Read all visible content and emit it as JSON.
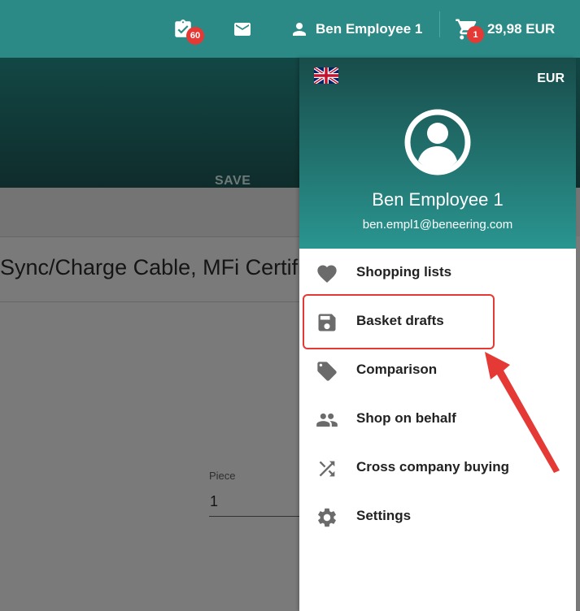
{
  "header": {
    "tasks": {
      "icon": "clipboard-check-icon",
      "badge": "60"
    },
    "messages": {
      "icon": "mail-icon"
    },
    "user": {
      "icon": "person-icon",
      "name": "Ben Employee 1"
    },
    "cart": {
      "icon": "cart-icon",
      "badge": "1",
      "total": "29,98 EUR"
    }
  },
  "background_page": {
    "save_label": "SAVE",
    "product_title": "Sync/Charge Cable, MFi Certified",
    "quantity_label": "Piece",
    "quantity_value": "1"
  },
  "account_panel": {
    "flag": "uk-flag-icon",
    "currency": "EUR",
    "avatar": "account-circle-icon",
    "name": "Ben Employee 1",
    "email": "ben.empl1@beneering.com",
    "menu": [
      {
        "label": "Shopping lists",
        "icon": "heart-icon"
      },
      {
        "label": "Basket drafts",
        "icon": "floppy-disk-icon"
      },
      {
        "label": "Comparison",
        "icon": "tag-icon"
      },
      {
        "label": "Shop on behalf",
        "icon": "people-icon"
      },
      {
        "label": "Cross company buying",
        "icon": "shuffle-icon"
      },
      {
        "label": "Settings",
        "icon": "gear-icon"
      }
    ]
  },
  "colors": {
    "primary": "#2b8a85",
    "header_dark": "#184c4a",
    "badge": "#e53935",
    "annotation": "#e53935",
    "icon_gray": "#6b6b6b"
  }
}
